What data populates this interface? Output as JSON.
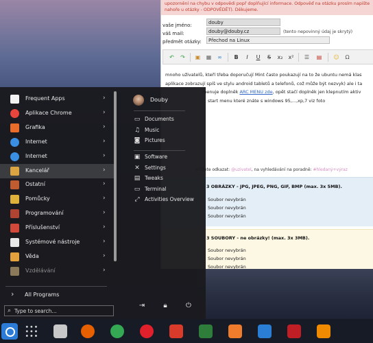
{
  "page": {
    "notice": "upozornění na chybu v odpovědi popř doplňující informace. Odpověď na otázku prosím napište nahoře u otázky - ODPOVĚDĚT). Děkujeme.",
    "name_label": "vaše jméno:",
    "name_value": "douby",
    "mail_label": "váš mail:",
    "mail_value": "douby@douby.cz",
    "mail_hint": "(tento nepovinný údaj je skrytý)",
    "subject_label": "předmět otázky:",
    "subject_value": "Přechod na Linux",
    "editor_line1": "mnoho uživatelů, kteří třeba doporučují Mint často poukazují na to že ubuntu nemá klas",
    "editor_line2": "aplikace zobrazují spíš ve stylu android tabletů a telefonů, což může být nezvyk) ale i ta",
    "editor_line3_pre": "menuje doplněk",
    "editor_link": "ARC MENU zde",
    "editor_line3_post": ", opět stačí doplněk jen klepnutím aktiv",
    "editor_line4": "start menu které znáte s windows 95,...,xp,7 viz foto",
    "link_row_pre": "můžete odkazat:",
    "link_row_user": "@uzivatel",
    "link_row_mid": ", na vyhledávání na poradně:",
    "link_row_tag": "#hledaný+výraz",
    "images_title": "3 OBRÁZKY - JPG, JPEG, PNG, GIF, BMP (max. 3x 5MB).",
    "files_title": "3 SOUBORY - ne obrázky! (max. 3x 3MB).",
    "no_file": "Soubor nevybrán"
  },
  "menu": {
    "categories": [
      {
        "label": "Frequent Apps",
        "icon": "heart-icon",
        "color": "#f2f2f2"
      },
      {
        "label": "Aplikace Chrome",
        "icon": "chrome-icon",
        "color": "#e8453c"
      },
      {
        "label": "Grafika",
        "icon": "graphics-icon",
        "color": "#e96d2a"
      },
      {
        "label": "Internet",
        "icon": "globe-icon",
        "color": "#3b8fe2"
      },
      {
        "label": "Internet",
        "icon": "globe-icon",
        "color": "#3b8fe2"
      },
      {
        "label": "Kancelář",
        "icon": "office-icon",
        "color": "#d9a441"
      },
      {
        "label": "Ostatní",
        "icon": "other-icon",
        "color": "#c05c2f"
      },
      {
        "label": "Pomůcky",
        "icon": "utilities-icon",
        "color": "#e0b13a"
      },
      {
        "label": "Programování",
        "icon": "programming-icon",
        "color": "#b04432"
      },
      {
        "label": "Příslušenství",
        "icon": "accessories-icon",
        "color": "#d0493a"
      },
      {
        "label": "Systémové nástroje",
        "icon": "system-tools-icon",
        "color": "#e8e8e8"
      },
      {
        "label": "Věda",
        "icon": "science-icon",
        "color": "#e3a23b"
      },
      {
        "label": "Vzdělávání",
        "icon": "education-icon",
        "color": "#8a7a5a"
      }
    ],
    "selected_index": 5,
    "all_programs": "All Programs",
    "search_placeholder": "Type to search...",
    "user_name": "Douby",
    "places": [
      {
        "label": "Documents",
        "icon": "document-icon"
      },
      {
        "label": "Music",
        "icon": "music-icon"
      },
      {
        "label": "Pictures",
        "icon": "camera-icon"
      }
    ],
    "system": [
      {
        "label": "Software",
        "icon": "bag-icon"
      },
      {
        "label": "Settings",
        "icon": "settings-icon"
      },
      {
        "label": "Tweaks",
        "icon": "tweaks-icon"
      },
      {
        "label": "Terminal",
        "icon": "terminal-icon"
      },
      {
        "label": "Activities Overview",
        "icon": "expand-icon"
      }
    ]
  },
  "taskbar": {
    "apps": [
      {
        "name": "app-grid-icon",
        "color": "#161b26"
      },
      {
        "name": "files-icon",
        "color": "#c8c8c8"
      },
      {
        "name": "firefox-icon",
        "color": "#e66000"
      },
      {
        "name": "chrome-icon",
        "color": "#34a853"
      },
      {
        "name": "opera-icon",
        "color": "#e0202b"
      },
      {
        "name": "doublecmd-icon",
        "color": "#d93b2b"
      },
      {
        "name": "text-editor-icon",
        "color": "#2e7d3a"
      },
      {
        "name": "software-store-icon",
        "color": "#ef7c2c"
      },
      {
        "name": "writer-icon",
        "color": "#2a7fd4"
      },
      {
        "name": "filezilla-icon",
        "color": "#bf1f24"
      },
      {
        "name": "vlc-icon",
        "color": "#f08a00"
      }
    ]
  }
}
